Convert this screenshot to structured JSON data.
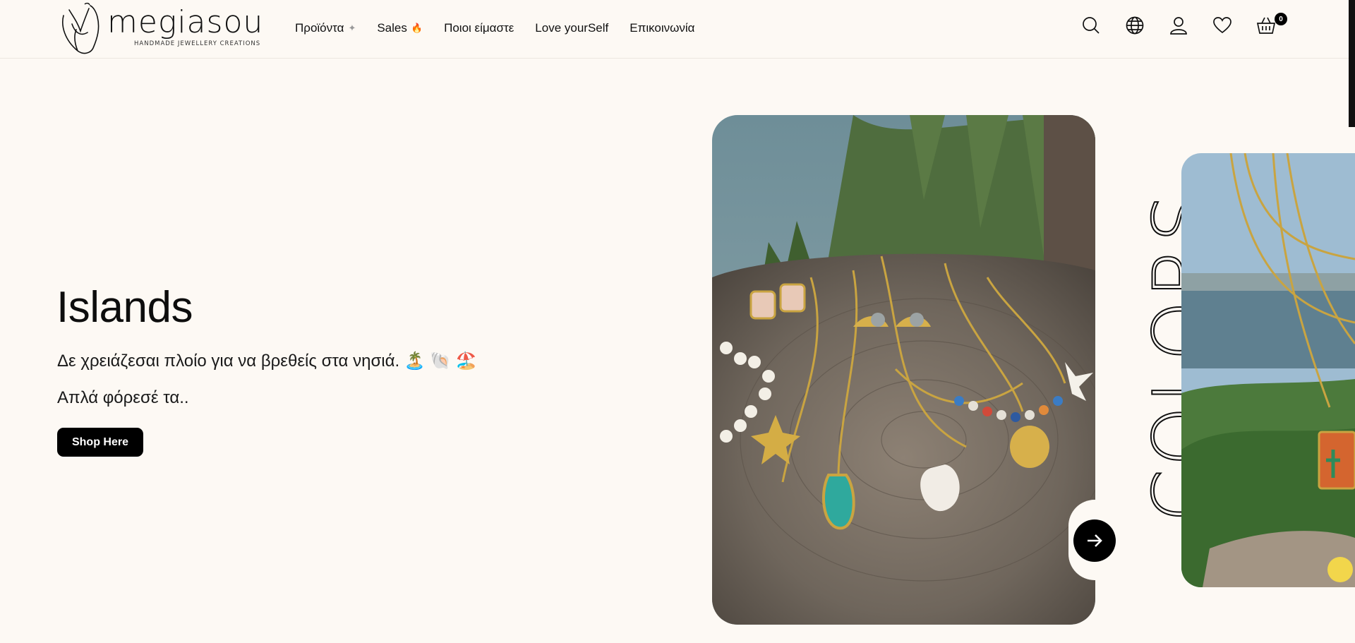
{
  "brand": {
    "name": "megiasou",
    "tagline": "HANDMADE JEWELLERY CREATIONS"
  },
  "nav": [
    {
      "label": "Προϊόντα",
      "emoji": "✦"
    },
    {
      "label": "Sales",
      "emoji": "🔥"
    },
    {
      "label": "Ποιοι είμαστε",
      "emoji": ""
    },
    {
      "label": "Love yourSelf",
      "emoji": ""
    },
    {
      "label": "Επικοινωνία",
      "emoji": ""
    }
  ],
  "header_icons": [
    "search-icon",
    "globe-icon",
    "user-icon",
    "heart-icon",
    "basket-icon"
  ],
  "cart": {
    "count": "0"
  },
  "hero": {
    "title": "Islands",
    "line1": "Δε χρειάζεσαι πλοίο για να βρεθείς στα νησιά. 🏝️ 🐚 🏖️",
    "line2": "Απλά φόρεσέ τα..",
    "cta": "Shop Here"
  },
  "next_slide": {
    "label": "COLORS",
    "icon": "arrow-right-icon"
  },
  "colors": {
    "accent": "#000000",
    "background": "#fdf9f4"
  }
}
